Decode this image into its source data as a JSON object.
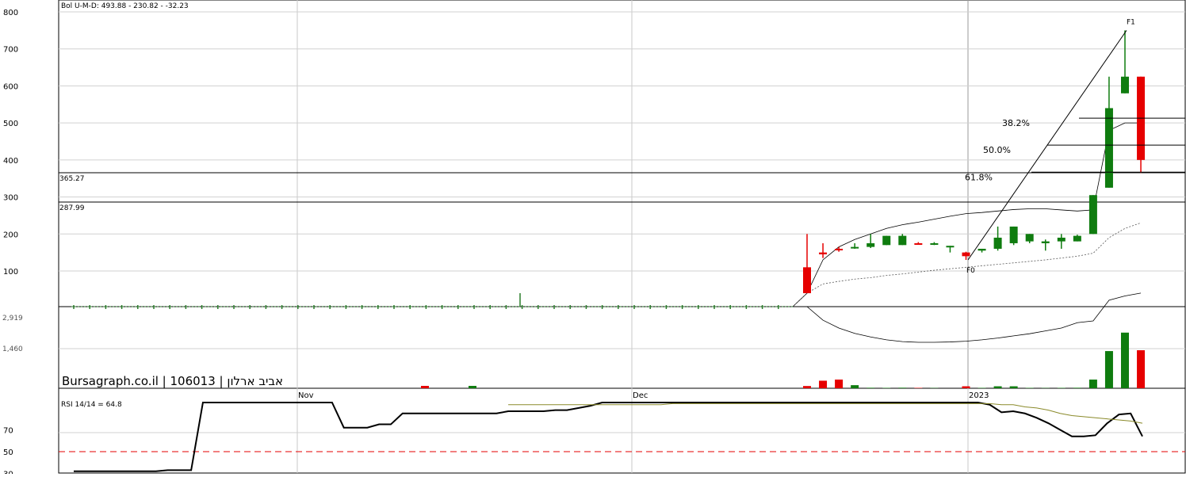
{
  "chart_data": {
    "type": "candlestick",
    "main_panel": {
      "indicator_label": "Bol U-M-D: 493.88 - 230.82 - -32.23",
      "yticks": [
        "800",
        "700",
        "600",
        "500",
        "400",
        "300",
        "200",
        "100"
      ],
      "ylim": [
        0,
        800
      ],
      "price_lines": [
        {
          "label": "365.27",
          "value": 365.27
        },
        {
          "label": "287.99",
          "value": 287.99
        }
      ],
      "fib_labels": [
        {
          "label": "38.2%",
          "value": 513
        },
        {
          "label": "50.0%",
          "value": 440
        },
        {
          "label": "61.8%",
          "value": 367
        }
      ],
      "fib_points": [
        {
          "label": "F0",
          "value": 130
        },
        {
          "label": "F1",
          "value": 750
        }
      ],
      "candles": [
        {
          "o": 110,
          "h": 200,
          "l": 40,
          "c": 40
        },
        {
          "o": 150,
          "h": 175,
          "l": 135,
          "c": 145
        },
        {
          "o": 160,
          "h": 165,
          "l": 152,
          "c": 158
        },
        {
          "o": 162,
          "h": 175,
          "l": 160,
          "c": 165
        },
        {
          "o": 165,
          "h": 200,
          "l": 162,
          "c": 175
        },
        {
          "o": 170,
          "h": 195,
          "l": 170,
          "c": 195
        },
        {
          "o": 170,
          "h": 200,
          "l": 170,
          "c": 195
        },
        {
          "o": 175,
          "h": 178,
          "l": 172,
          "c": 172
        },
        {
          "o": 172,
          "h": 178,
          "l": 170,
          "c": 175
        },
        {
          "o": 165,
          "h": 168,
          "l": 150,
          "c": 168
        },
        {
          "o": 150,
          "h": 152,
          "l": 130,
          "c": 140
        },
        {
          "o": 155,
          "h": 160,
          "l": 150,
          "c": 160
        },
        {
          "o": 160,
          "h": 220,
          "l": 155,
          "c": 190
        },
        {
          "o": 175,
          "h": 220,
          "l": 170,
          "c": 220
        },
        {
          "o": 180,
          "h": 200,
          "l": 175,
          "c": 200
        },
        {
          "o": 175,
          "h": 185,
          "l": 155,
          "c": 180
        },
        {
          "o": 180,
          "h": 200,
          "l": 160,
          "c": 190
        },
        {
          "o": 180,
          "h": 198,
          "l": 180,
          "c": 195
        },
        {
          "o": 200,
          "h": 305,
          "l": 200,
          "c": 305
        },
        {
          "o": 325,
          "h": 625,
          "l": 325,
          "c": 540
        },
        {
          "o": 580,
          "h": 750,
          "l": 580,
          "c": 625
        },
        {
          "o": 625,
          "h": 625,
          "l": 365,
          "c": 400
        }
      ],
      "bollinger_upper": [
        40,
        130,
        165,
        185,
        200,
        215,
        225,
        232,
        240,
        248,
        255,
        258,
        262,
        266,
        268,
        268,
        265,
        262,
        265,
        480,
        500,
        500
      ],
      "bollinger_middle": [
        40,
        65,
        72,
        78,
        82,
        88,
        92,
        97,
        102,
        106,
        110,
        114,
        118,
        122,
        126,
        130,
        135,
        140,
        148,
        190,
        215,
        230
      ]
    },
    "volume_panel": {
      "yticks": [
        "2,919",
        "1,460"
      ],
      "volumes": [
        80,
        270,
        310,
        110,
        18,
        14,
        20,
        14,
        10,
        0,
        70,
        14,
        70,
        70,
        14,
        10,
        14,
        18,
        310,
        1330,
        1990,
        1360
      ],
      "spike_indexes": [
        15,
        19
      ],
      "spike_volumes": [
        60,
        40
      ],
      "flag_line_ratio": [
        0,
        0.38,
        0.6,
        0.75,
        0.85,
        0.93,
        0.98,
        1.0,
        1.0,
        0.99,
        0.97,
        0.93,
        0.88,
        0.82,
        0.76,
        0.68,
        0.6,
        0.45,
        0.4,
        -0.18,
        -0.3,
        -0.38
      ]
    },
    "x_labels": [
      "Nov",
      "Dec",
      "2023"
    ],
    "rsi_panel": {
      "label": "RSI 14/14 = 64.8",
      "yticks": [
        "70",
        "50",
        "30"
      ],
      "ylim": [
        30,
        98
      ],
      "threshold": 50,
      "rsi": [
        32,
        32,
        32,
        32,
        32,
        32,
        32,
        32,
        33,
        33,
        33,
        95,
        95,
        95,
        95,
        95,
        95,
        95,
        95,
        95,
        95,
        95,
        95,
        72,
        72,
        72,
        75,
        75,
        85,
        85,
        85,
        85,
        85,
        85,
        85,
        85,
        85,
        87,
        87,
        87,
        87,
        88,
        88,
        90,
        92,
        95,
        95,
        95,
        95,
        95,
        95,
        95,
        95,
        95,
        95,
        95,
        95,
        95,
        95,
        95,
        95,
        95,
        95,
        95,
        95,
        95,
        95,
        95,
        95,
        95,
        95,
        95,
        95,
        95,
        95,
        95,
        95,
        95,
        93,
        86,
        87,
        85,
        81,
        76,
        70,
        64,
        64,
        65,
        76,
        84,
        85,
        64
      ],
      "rsi_signal": [
        86,
        86,
        85,
        84,
        84,
        84,
        85,
        85,
        85,
        86,
        86,
        86,
        87,
        87,
        88,
        88,
        89,
        89,
        89,
        90,
        90,
        90,
        91,
        91,
        91,
        92,
        92,
        92,
        93,
        93,
        93,
        93,
        93,
        93,
        93,
        93,
        93,
        93,
        93,
        93,
        93,
        93,
        93,
        93,
        93,
        93,
        93,
        93,
        93,
        93,
        93,
        94,
        94,
        94,
        94,
        94,
        94,
        94,
        94,
        94,
        94,
        94,
        94,
        94,
        94,
        94,
        94,
        94,
        94,
        94,
        94,
        94,
        94,
        94,
        94,
        94,
        94,
        94,
        94,
        93,
        93,
        91,
        90,
        88,
        85,
        83,
        82,
        81,
        80,
        79,
        78,
        76
      ],
      "rsi_segment_ratio": [
        0.02,
        0.0
      ]
    },
    "brand_label": "Bursagraph.co.il | 106013 | אביב ארלון"
  }
}
